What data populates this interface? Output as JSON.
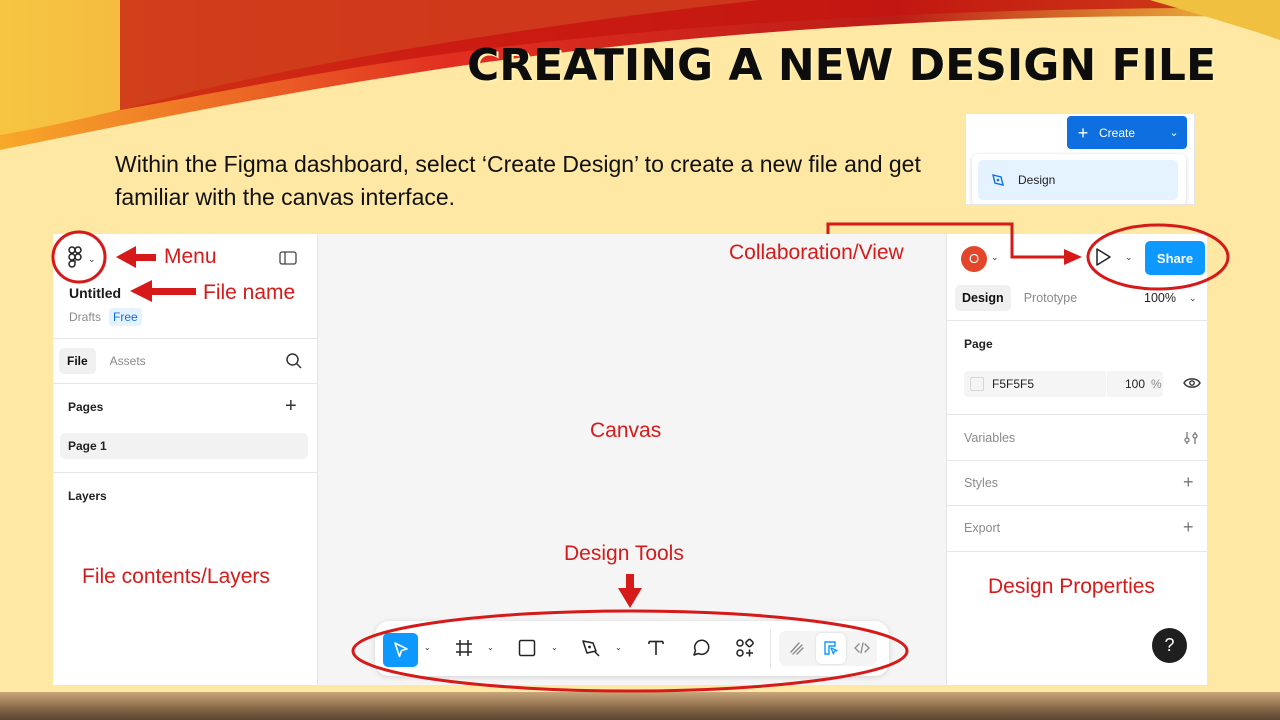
{
  "slide": {
    "title": "Creating a New Design File",
    "subtitle": "Within the Figma dashboard, select ‘Create Design’ to create a new file and get familiar with the canvas interface."
  },
  "create_snippet": {
    "button_label": "Create",
    "menu_item": "Design",
    "accent": "#0d6fe0"
  },
  "figma": {
    "left_panel": {
      "file_name": "Untitled",
      "location": "Drafts",
      "plan_badge": "Free",
      "tabs": [
        {
          "label": "File",
          "active": true
        },
        {
          "label": "Assets",
          "active": false
        }
      ],
      "pages_header": "Pages",
      "pages": [
        {
          "label": "Page 1",
          "selected": true
        }
      ],
      "layers_header": "Layers"
    },
    "right_panel": {
      "avatar_initial": "O",
      "avatar_color": "#e3462a",
      "share_label": "Share",
      "tabs": [
        {
          "label": "Design",
          "active": true
        },
        {
          "label": "Prototype",
          "active": false
        }
      ],
      "zoom": "100%",
      "page_section": "Page",
      "page_fill_hex": "F5F5F5",
      "page_fill_opacity": "100",
      "page_fill_pct": "%",
      "variables_label": "Variables",
      "styles_label": "Styles",
      "export_label": "Export",
      "help_label": "?"
    },
    "toolbar": {
      "tools": [
        "move-tool",
        "frame-tool",
        "shape-tool",
        "pen-tool",
        "text-tool",
        "comment-tool",
        "actions-tool"
      ],
      "modes": [
        "draw-mode",
        "design-mode",
        "dev-mode"
      ],
      "active_tool": "move-tool",
      "active_mode": "design-mode"
    }
  },
  "annotations": {
    "menu": "Menu",
    "file_name": "File name",
    "collaboration": "Collaboration/View",
    "canvas": "Canvas",
    "design_tools": "Design Tools",
    "file_contents": "File contents/Layers",
    "design_properties": "Design Properties",
    "color": "#d61a1a"
  }
}
